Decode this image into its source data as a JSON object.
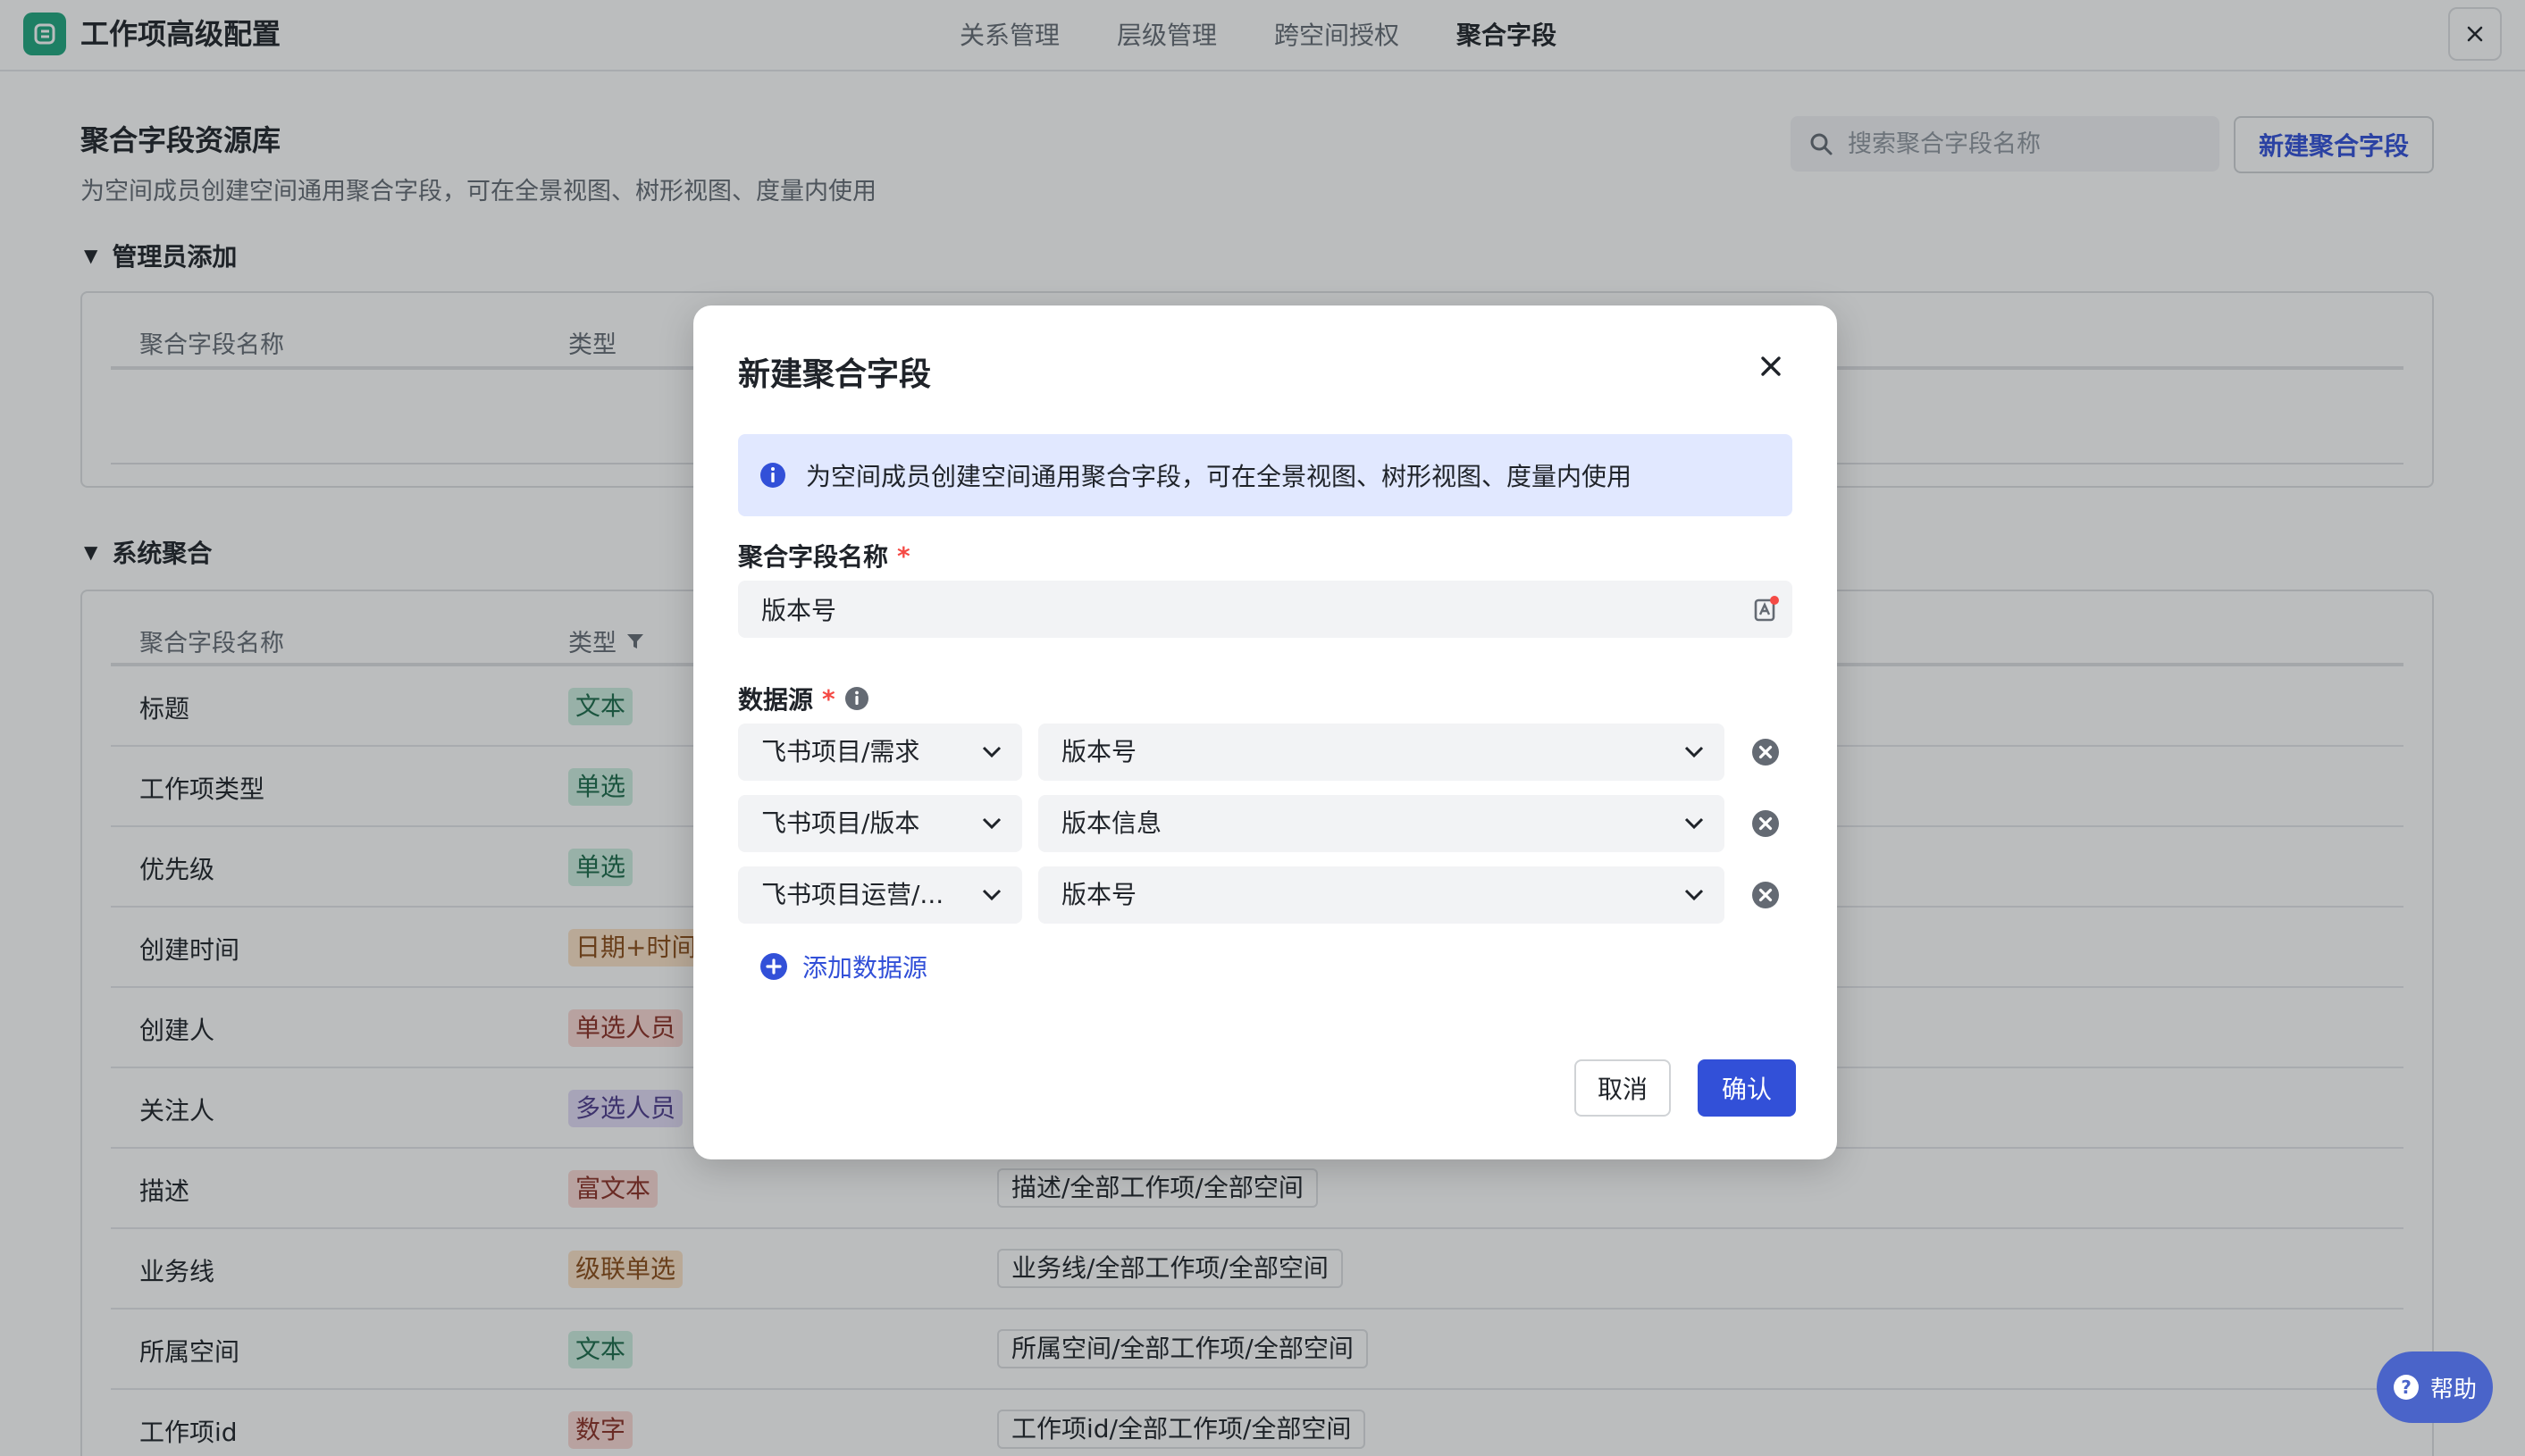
{
  "header": {
    "app_title": "工作项高级配置",
    "tabs": [
      {
        "label": "关系管理"
      },
      {
        "label": "层级管理"
      },
      {
        "label": "跨空间授权"
      },
      {
        "label": "聚合字段"
      }
    ],
    "active_tab": "聚合字段"
  },
  "page": {
    "title": "聚合字段资源库",
    "subtitle": "为空间成员创建空间通用聚合字段，可在全景视图、树形视图、度量内使用",
    "search_placeholder": "搜索聚合字段名称",
    "new_button": "新建聚合字段"
  },
  "admin_section": {
    "title": "管理员添加",
    "columns": [
      "聚合字段名称",
      "类型"
    ]
  },
  "system_section": {
    "title": "系统聚合",
    "columns": [
      "聚合字段名称",
      "类型"
    ],
    "rows": [
      {
        "name": "标题",
        "type": "文本"
      },
      {
        "name": "工作项类型",
        "type": "单选"
      },
      {
        "name": "优先级",
        "type": "单选"
      },
      {
        "name": "创建时间",
        "type": "日期+时间"
      },
      {
        "name": "创建人",
        "type": "单选人员"
      },
      {
        "name": "关注人",
        "type": "多选人员"
      },
      {
        "name": "描述",
        "type": "富文本",
        "source": "描述/全部工作项/全部空间"
      },
      {
        "name": "业务线",
        "type": "级联单选",
        "source": "业务线/全部工作项/全部空间"
      },
      {
        "name": "所属空间",
        "type": "文本",
        "source": "所属空间/全部工作项/全部空间"
      },
      {
        "name": "工作项id",
        "type": "数字",
        "source": "工作项id/全部工作项/全部空间"
      }
    ]
  },
  "modal": {
    "title": "新建聚合字段",
    "info_text": "为空间成员创建空间通用聚合字段，可在全景视图、树形视图、度量内使用",
    "name_label": "聚合字段名称",
    "name_value": "版本号",
    "required_mark": "*",
    "datasource_label": "数据源",
    "datasources": [
      {
        "source": "飞书项目/需求",
        "field": "版本号"
      },
      {
        "source": "飞书项目/版本",
        "field": "版本信息"
      },
      {
        "source": "飞书项目运营/...",
        "field": "版本号"
      }
    ],
    "add_datasource": "添加数据源",
    "cancel": "取消",
    "confirm": "确认"
  },
  "help": {
    "label": "帮助"
  },
  "colors": {
    "accent": "#3250d8",
    "logo": "#1fa67f",
    "required": "#f54a45",
    "info_bg": "#e1e8ff"
  }
}
